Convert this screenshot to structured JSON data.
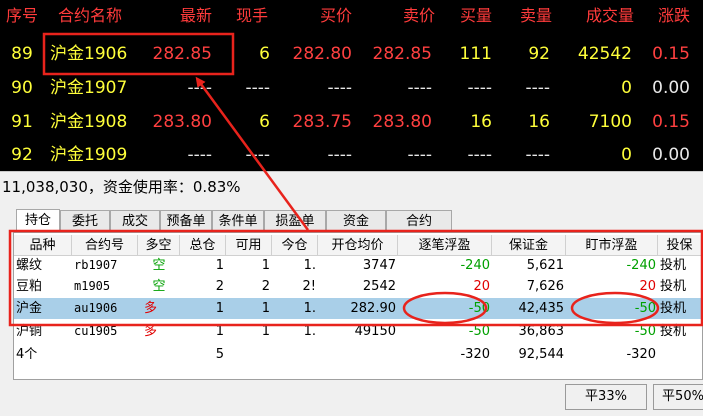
{
  "quote": {
    "headers": [
      "序号",
      "合约名称",
      "最新",
      "现手",
      "买价",
      "卖价",
      "买量",
      "卖量",
      "成交量",
      "涨跌"
    ],
    "rows": [
      {
        "seq": "89",
        "name": "沪金1906",
        "last": "282.85",
        "hand": "6",
        "bid": "282.80",
        "ask": "282.85",
        "bid_qty": "111",
        "ask_qty": "92",
        "volume": "42542",
        "change": "0.15"
      },
      {
        "seq": "90",
        "name": "沪金1907",
        "last": "----",
        "hand": "----",
        "bid": "----",
        "ask": "----",
        "bid_qty": "----",
        "ask_qty": "----",
        "volume": "0",
        "change": "0.00"
      },
      {
        "seq": "91",
        "name": "沪金1908",
        "last": "283.80",
        "hand": "6",
        "bid": "283.75",
        "ask": "283.80",
        "bid_qty": "16",
        "ask_qty": "16",
        "volume": "7100",
        "change": "0.15"
      },
      {
        "seq": "92",
        "name": "沪金1909",
        "last": "----",
        "hand": "----",
        "bid": "----",
        "ask": "----",
        "bid_qty": "----",
        "ask_qty": "----",
        "volume": "0",
        "change": "0.00"
      }
    ]
  },
  "funds_bar": "11,038,030，资金使用率：0.83%",
  "tabs": [
    "持仓",
    "委托",
    "成交",
    "预备单",
    "条件单",
    "损盈单",
    "资金",
    "合约"
  ],
  "positions": {
    "headers": [
      "品种",
      "合约号",
      "多空",
      "总仓",
      "可用",
      "今仓",
      "开仓均价",
      "逐笔浮盈",
      "保证金",
      "盯市浮盈",
      "投保"
    ],
    "rows": [
      {
        "variety": "螺纹",
        "code": "rb1907",
        "side": "空",
        "total": "1",
        "avail": "1",
        "today": "1.",
        "avg": "3747",
        "float_trade": "-240",
        "margin": "5,621",
        "float_mkt": "-240",
        "hedge": "投机"
      },
      {
        "variety": "豆粕",
        "code": "m1905",
        "side": "空",
        "total": "2",
        "avail": "2",
        "today": "2!",
        "avg": "2542",
        "float_trade": "20",
        "margin": "7,626",
        "float_mkt": "20",
        "hedge": "投机"
      },
      {
        "variety": "沪金",
        "code": "au1906",
        "side": "多",
        "total": "1",
        "avail": "1",
        "today": "1.",
        "avg": "282.90",
        "float_trade": "-50",
        "margin": "42,435",
        "float_mkt": "-50",
        "hedge": "投机"
      },
      {
        "variety": "沪铜",
        "code": "cu1905",
        "side": "多",
        "total": "1",
        "avail": "1",
        "today": "1.",
        "avg": "49150",
        "float_trade": "-50",
        "margin": "36,863",
        "float_mkt": "-50",
        "hedge": "投机"
      }
    ],
    "total_row": {
      "variety": "4个",
      "total": "5",
      "float_trade": "-320",
      "margin": "92,544",
      "float_mkt": "-320"
    }
  },
  "buttons": {
    "close33": "平33%",
    "close50": "平50%"
  },
  "colors": {
    "quote_bg": "#000000",
    "quote_header": "#ff3b3b",
    "quote_yellow": "#ffff3a",
    "quote_red": "#ff4040",
    "annotation_red": "#e8231c",
    "selected_row": "#a9cfe8",
    "profit_red": "#e00000",
    "loss_green": "#00a000"
  }
}
